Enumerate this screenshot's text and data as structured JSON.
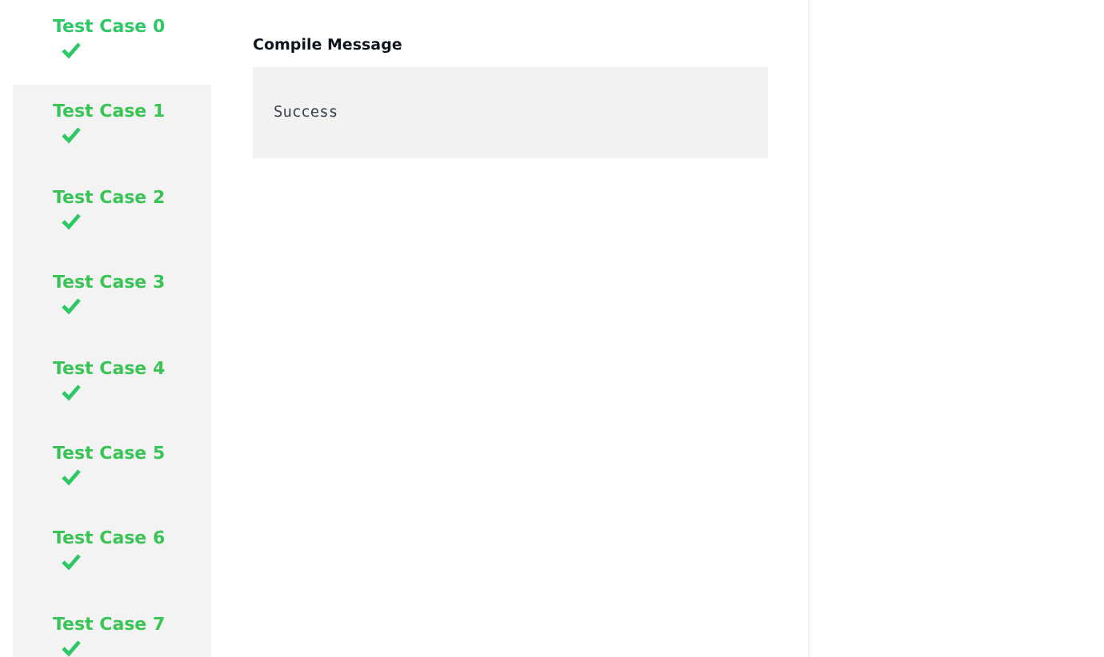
{
  "test_cases": [
    {
      "label": "Test Case 0",
      "selected": true,
      "passed": true
    },
    {
      "label": "Test Case 1",
      "selected": false,
      "passed": true
    },
    {
      "label": "Test Case 2",
      "selected": false,
      "passed": true
    },
    {
      "label": "Test Case 3",
      "selected": false,
      "passed": true
    },
    {
      "label": "Test Case 4",
      "selected": false,
      "passed": true
    },
    {
      "label": "Test Case 5",
      "selected": false,
      "passed": true
    },
    {
      "label": "Test Case 6",
      "selected": false,
      "passed": true
    },
    {
      "label": "Test Case 7",
      "selected": false,
      "passed": true
    }
  ],
  "compile_message": {
    "heading": "Compile Message",
    "text": "Success"
  }
}
